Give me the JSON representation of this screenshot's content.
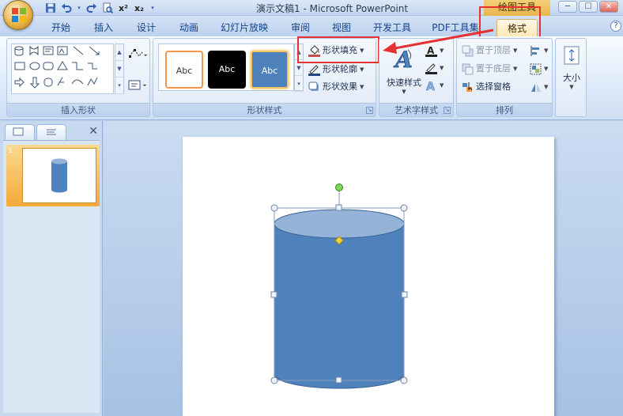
{
  "window": {
    "title": "演示文稿1 - Microsoft PowerPoint",
    "context_tool": "绘图工具"
  },
  "tabs": [
    {
      "label": "开始"
    },
    {
      "label": "插入"
    },
    {
      "label": "设计"
    },
    {
      "label": "动画"
    },
    {
      "label": "幻灯片放映"
    },
    {
      "label": "审阅"
    },
    {
      "label": "视图"
    },
    {
      "label": "开发工具"
    },
    {
      "label": "PDF工具集"
    },
    {
      "label": "格式",
      "active": true
    }
  ],
  "groups": {
    "insert_shapes": {
      "label": "插入形状"
    },
    "shape_styles": {
      "label": "形状样式",
      "thumb_labels": [
        "Abc",
        "Abc",
        "Abc"
      ],
      "fill": "形状填充",
      "outline": "形状轮廓",
      "effect": "形状效果"
    },
    "wordart": {
      "label": "艺术字样式",
      "quick_styles": "快速样式"
    },
    "arrange": {
      "label": "排列",
      "bring_front": "置于顶层",
      "send_back": "置于底层",
      "selection_pane": "选择窗格"
    },
    "size": {
      "label": "大小"
    }
  },
  "colors": {
    "highlight": "#e63131",
    "shape_fill": "#4f81bd",
    "shape_stroke": "#3a6597",
    "active_tab": "#ffe8b5"
  },
  "icons": [
    "office-logo",
    "save-icon",
    "undo-icon",
    "redo-icon",
    "print-preview-icon",
    "superscript-icon",
    "subscript-icon",
    "paint-bucket-icon",
    "pen-icon",
    "effects-icon",
    "wordart-a-icon",
    "text-fill-icon",
    "text-outline-icon",
    "text-effects-icon",
    "bring-front-icon",
    "send-back-icon",
    "selection-pane-icon",
    "align-icon",
    "group-icon",
    "rotate-icon",
    "size-icon",
    "close-icon"
  ]
}
